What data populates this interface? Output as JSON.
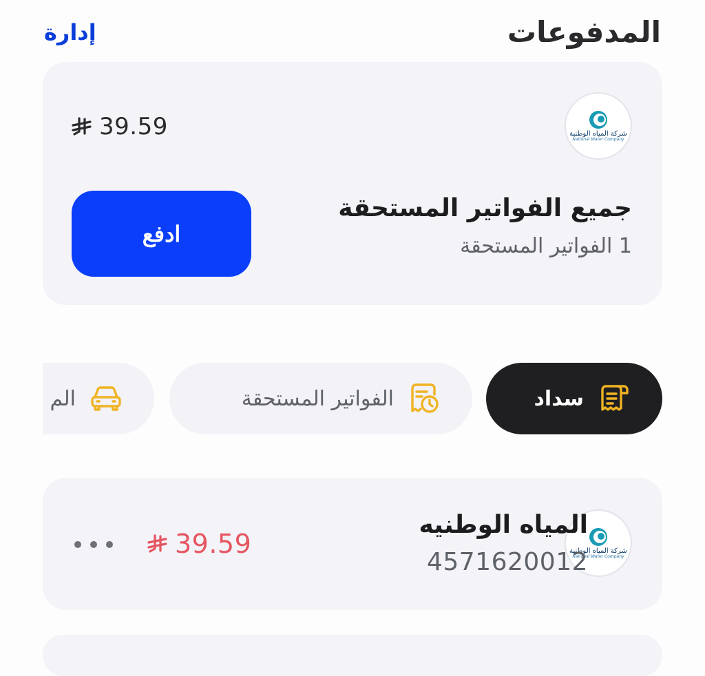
{
  "header": {
    "title": "المدفوعات",
    "manage_label": "إدارة"
  },
  "summary": {
    "provider_logo": {
      "text_ar": "شركة المياه الوطنية",
      "text_en": "National Water Company"
    },
    "amount": "39.59",
    "currency_icon": "saudi-riyal-icon",
    "due_title": "جميع الفواتير المستحقة",
    "due_subtitle": "1 الفواتير المستحقة",
    "pay_label": "ادفع"
  },
  "chips": [
    {
      "label": "سداد",
      "icon": "receipt-icon",
      "active": true
    },
    {
      "label": "الفواتير المستحقة",
      "icon": "bill-clock-icon",
      "active": false
    },
    {
      "label": "الم",
      "icon": "car-icon",
      "active": false
    }
  ],
  "bill": {
    "name": "المياه الوطنيه",
    "account_number": "4571620012",
    "amount": "39.59",
    "amount_color": "#e55560",
    "more_icon": "ellipsis-icon"
  },
  "colors": {
    "accent": "#0a3ef8",
    "link": "#0a3ed9",
    "chip_icon": "#f0b323",
    "chip_active_bg": "#1f1f21"
  }
}
